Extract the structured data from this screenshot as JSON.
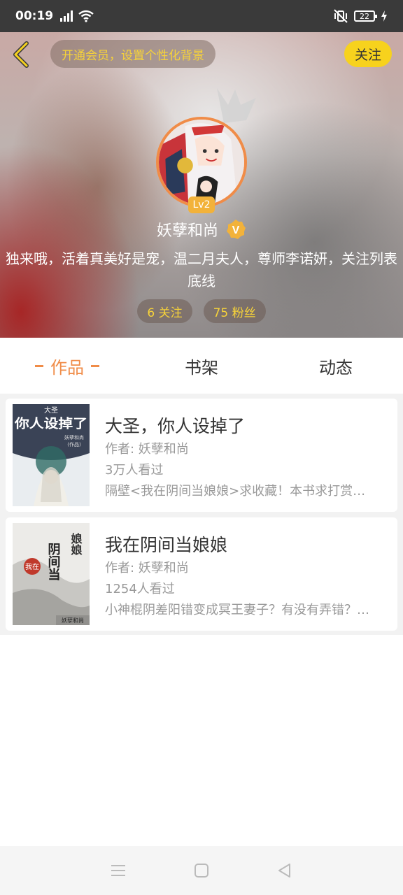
{
  "status_bar": {
    "time": "00:19",
    "battery": "22"
  },
  "header": {
    "vip_banner": "开通会员，设置个性化背景",
    "follow_label": "关注",
    "level": "Lv2",
    "username": "妖孽和尚",
    "verified_mark": "V",
    "bio": "独来哦，活着真美好是宠，温二月夫人，尊师李诺妍，关注列表底线",
    "stats": {
      "following": "6 关注",
      "fans": "75 粉丝"
    }
  },
  "tabs": [
    {
      "label": "作品",
      "active": true
    },
    {
      "label": "书架",
      "active": false
    },
    {
      "label": "动态",
      "active": false
    }
  ],
  "books": [
    {
      "title": "大圣，你人设掉了",
      "author": "作者: 妖孽和尚",
      "views": "3万人看过",
      "desc": "隔壁<我在阴间当娘娘>求收藏！本书求打赏…",
      "cover_text": [
        "大圣",
        "你人设掉了",
        "妖孽和尚",
        "(作品)"
      ]
    },
    {
      "title": "我在阴间当娘娘",
      "author": "作者: 妖孽和尚",
      "views": "1254人看过",
      "desc": "小神棍阴差阳错变成冥王妻子？有没有弄错？…",
      "cover_text": [
        "我在",
        "阴间当",
        "娘娘",
        "妖孽和尚"
      ]
    }
  ],
  "colors": {
    "accent": "#f08c48",
    "follow": "#f7d21d",
    "gold": "#f6d23a"
  }
}
